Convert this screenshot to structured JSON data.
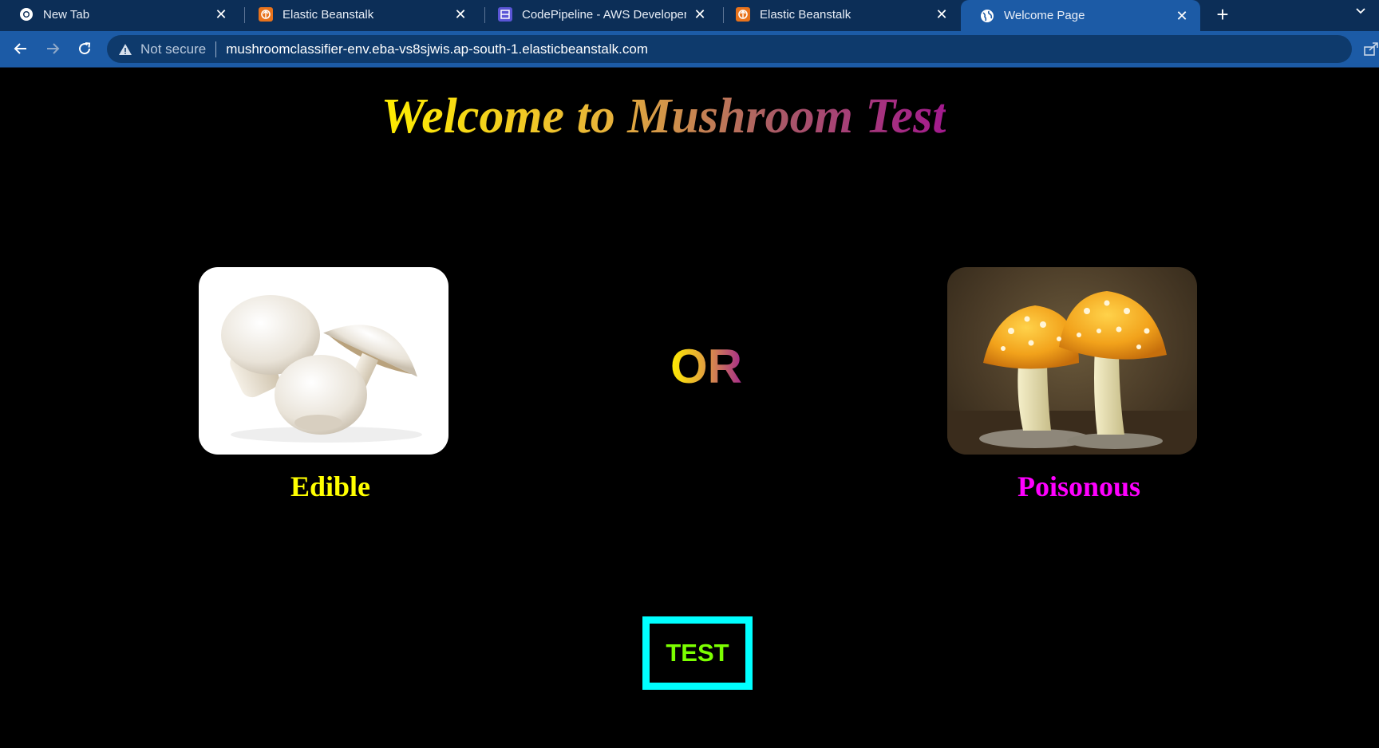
{
  "browser": {
    "tabs": [
      {
        "title": "New Tab",
        "icon": "chrome-icon"
      },
      {
        "title": "Elastic Beanstalk",
        "icon": "elastic-beanstalk-icon"
      },
      {
        "title": "CodePipeline - AWS Developer To",
        "icon": "codepipeline-icon"
      },
      {
        "title": "Elastic Beanstalk",
        "icon": "elastic-beanstalk-icon"
      },
      {
        "title": "Welcome Page",
        "icon": "globe-icon"
      }
    ],
    "close_glyph": "✕",
    "new_tab_glyph": "+",
    "address": {
      "security_label": "Not secure",
      "url": "mushroomclassifier-env.eba-vs8sjwis.ap-south-1.elasticbeanstalk.com"
    },
    "colors": {
      "tabstrip": "#0c2e57",
      "toolbar": "#1c5ba6",
      "omnibox": "#0e3a6c"
    }
  },
  "page": {
    "heading": "Welcome to Mushroom Test",
    "edible_label": "Edible",
    "or_label": "OR",
    "poisonous_label": "Poisonous",
    "test_button_label": "TEST",
    "colors": {
      "edible": "#ffff00",
      "poisonous": "#ff00ff",
      "test_text": "#7cff00",
      "test_border": "#00ffff",
      "background": "#000000"
    }
  }
}
